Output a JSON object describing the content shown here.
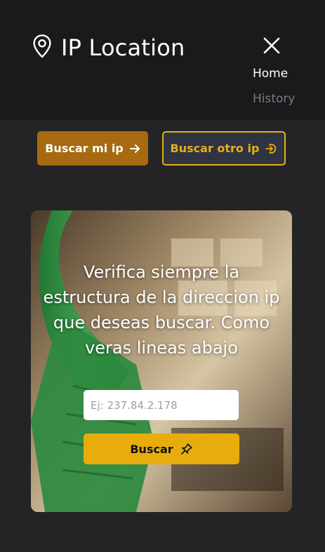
{
  "header": {
    "brand_title": "IP Location",
    "brand_icon": "map-pin-icon",
    "close_icon": "close-icon",
    "nav": {
      "home": "Home",
      "history": "History"
    }
  },
  "actions": {
    "my_ip_label": "Buscar mi ip",
    "other_ip_label": "Buscar otro ip"
  },
  "hero": {
    "message": "Verifica siempre la estructura de la direccion ip que deseas buscar. Como veras lineas abajo",
    "input_placeholder": "Ej: 237.84.2.178",
    "input_value": "",
    "search_label": "Buscar",
    "search_icon": "pin-icon"
  },
  "colors": {
    "header_bg": "#1a1a1c",
    "page_bg": "#242426",
    "primary_btn": "#a86a10",
    "accent": "#e5b116",
    "search_btn": "#e8ad0d"
  }
}
